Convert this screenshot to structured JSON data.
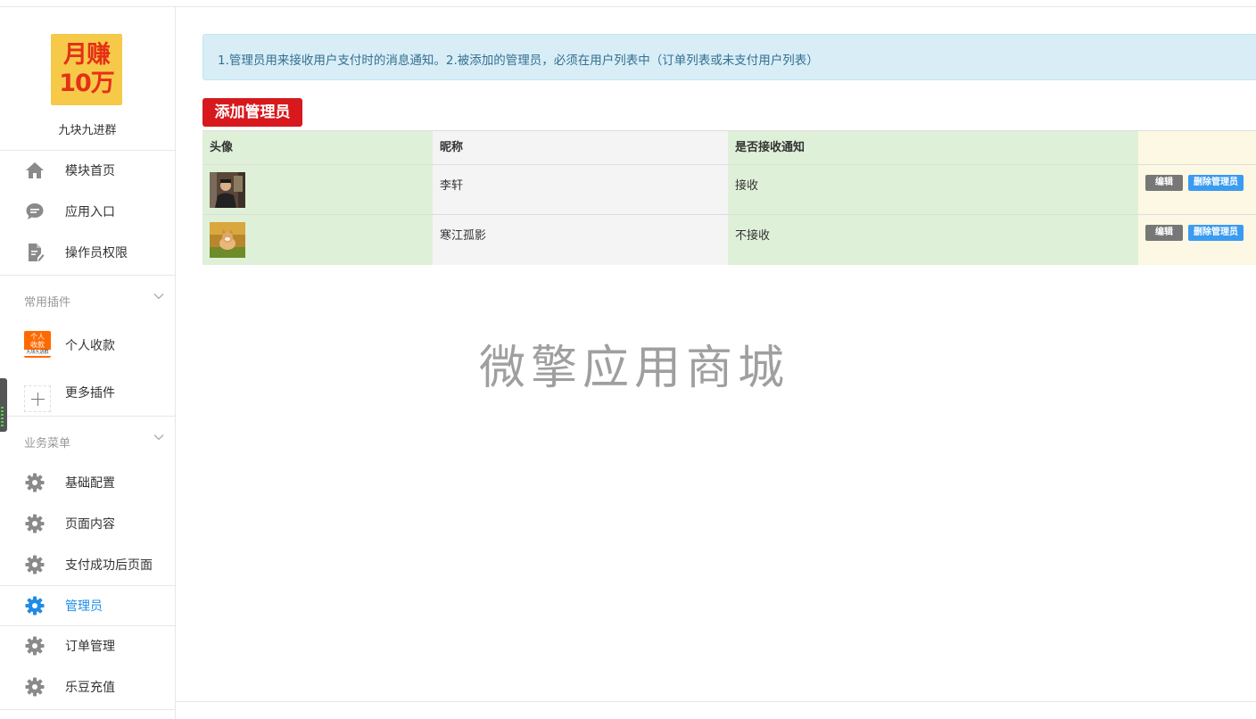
{
  "app": {
    "logo_line1": "月赚",
    "logo_line2": "10万",
    "name": "九块九进群"
  },
  "sidebar": {
    "main_items": [
      {
        "label": "模块首页",
        "icon": "home-icon"
      },
      {
        "label": "应用入口",
        "icon": "chat-bubble-icon"
      },
      {
        "label": "操作员权限",
        "icon": "document-edit-icon"
      }
    ],
    "plugin_group": {
      "title": "常用插件",
      "items": [
        {
          "label": "个人收款",
          "icon": "personal-payment-icon",
          "badge_line1": "个人",
          "badge_line2": "收款",
          "badge_line3": "九块九进群"
        },
        {
          "label": "更多插件",
          "icon": "plus-icon"
        }
      ]
    },
    "business_group": {
      "title": "业务菜单",
      "items": [
        {
          "label": "基础配置",
          "icon": "gear-icon"
        },
        {
          "label": "页面内容",
          "icon": "gear-icon"
        },
        {
          "label": "支付成功后页面",
          "icon": "gear-icon"
        },
        {
          "label": "管理员",
          "icon": "gear-icon",
          "active": true
        },
        {
          "label": "订单管理",
          "icon": "gear-icon"
        },
        {
          "label": "乐豆充值",
          "icon": "gear-icon"
        }
      ]
    }
  },
  "notice": {
    "text": "1.管理员用来接收用户支付时的消息通知。2.被添加的管理员，必须在用户列表中（订单列表或未支付用户列表）"
  },
  "toolbar": {
    "add_label": "添加管理员"
  },
  "table": {
    "headers": {
      "avatar": "头像",
      "nickname": "昵称",
      "notify": "是否接收通知",
      "ops": ""
    },
    "rows": [
      {
        "nickname": "李轩",
        "notify": "接收",
        "edit_label": "编辑",
        "delete_label": "删除管理员"
      },
      {
        "nickname": "寒江孤影",
        "notify": "不接收",
        "edit_label": "编辑",
        "delete_label": "删除管理员"
      }
    ]
  },
  "watermark": "微擎应用商城",
  "colors": {
    "accent": "#1e8ce6",
    "add_button": "#d7191d",
    "notice_bg": "#d9edf7",
    "row_green": "#dff0d8",
    "row_yellow": "#fcf8e3"
  }
}
